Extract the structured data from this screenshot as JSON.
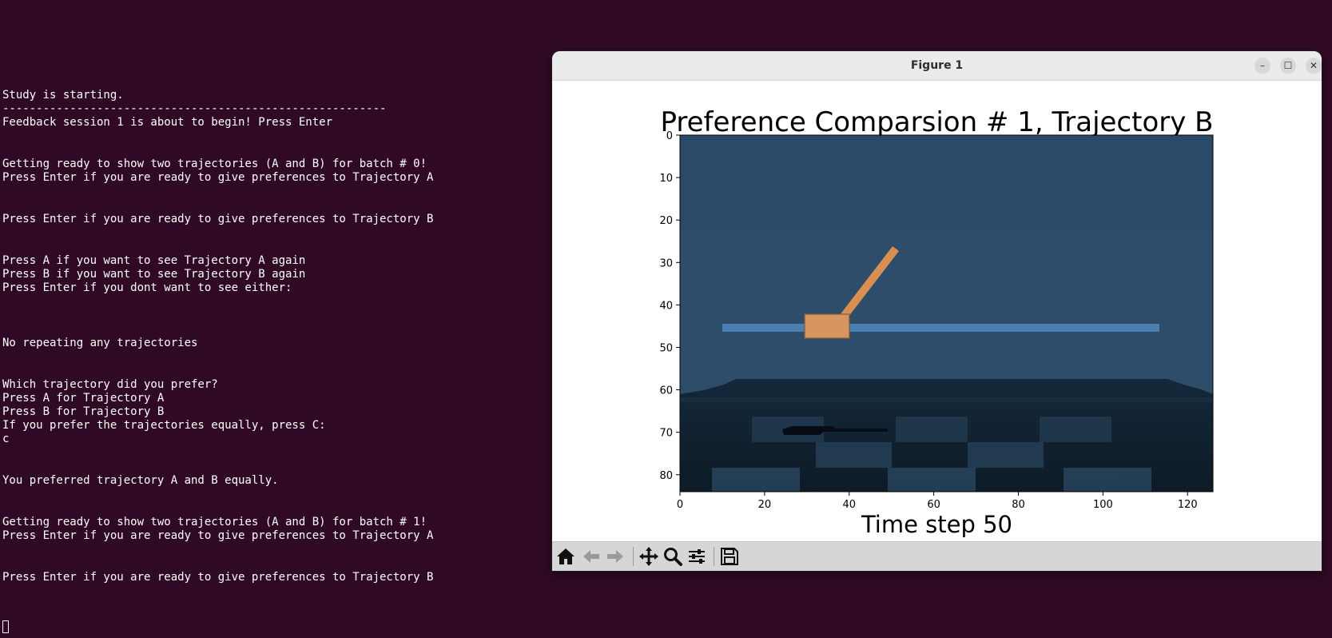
{
  "terminal": {
    "lines": [
      "Study is starting.",
      "---------------------------------------------------------",
      "Feedback session 1 is about to begin! Press Enter",
      "Getting ready to show two trajectories (A and B) for batch # 0!",
      "Press Enter if you are ready to give preferences to Trajectory A",
      "Press Enter if you are ready to give preferences to Trajectory B",
      "Press A if you want to see Trajectory A again",
      "Press B if you want to see Trajectory B again",
      "Press Enter if you dont want to see either:",
      "No repeating any trajectories",
      "Which trajectory did you prefer?",
      "Press A for Trajectory A",
      "Press B for Trajectory B",
      "If you prefer the trajectories equally, press C:",
      "c",
      "You preferred trajectory A and B equally.",
      "Getting ready to show two trajectories (A and B) for batch # 1!",
      "Press Enter if you are ready to give preferences to Trajectory A",
      "Press Enter if you are ready to give preferences to Trajectory B"
    ]
  },
  "window": {
    "title": "Figure 1",
    "minimize_glyph": "–",
    "maximize_glyph": "☐",
    "close_glyph": "✕"
  },
  "figure": {
    "title": "Preference Comparsion # 1, Trajectory B",
    "xlabel": "Time step 50"
  },
  "chart_data": {
    "type": "image",
    "title": "Preference Comparsion # 1, Trajectory B",
    "xlabel": "Time step 50",
    "ylabel": "",
    "xlim": [
      0,
      126
    ],
    "ylim": [
      84,
      0
    ],
    "xticks": [
      0,
      20,
      40,
      60,
      80,
      100,
      120
    ],
    "yticks": [
      0,
      10,
      20,
      30,
      40,
      50,
      60,
      70,
      80
    ]
  },
  "toolbar": {
    "icons": [
      "home-icon",
      "back-icon",
      "forward-icon",
      "pan-icon",
      "zoom-icon",
      "configure-icon",
      "save-icon"
    ]
  },
  "colors": {
    "terminal_bg": "#300a24",
    "sky": "#2e4d6b",
    "rail": "#4a7fb0",
    "cart": "#d99560",
    "pole": "#d98f52",
    "floor_dark": "#0f1d2a",
    "floor_light": "#2c4b66"
  }
}
